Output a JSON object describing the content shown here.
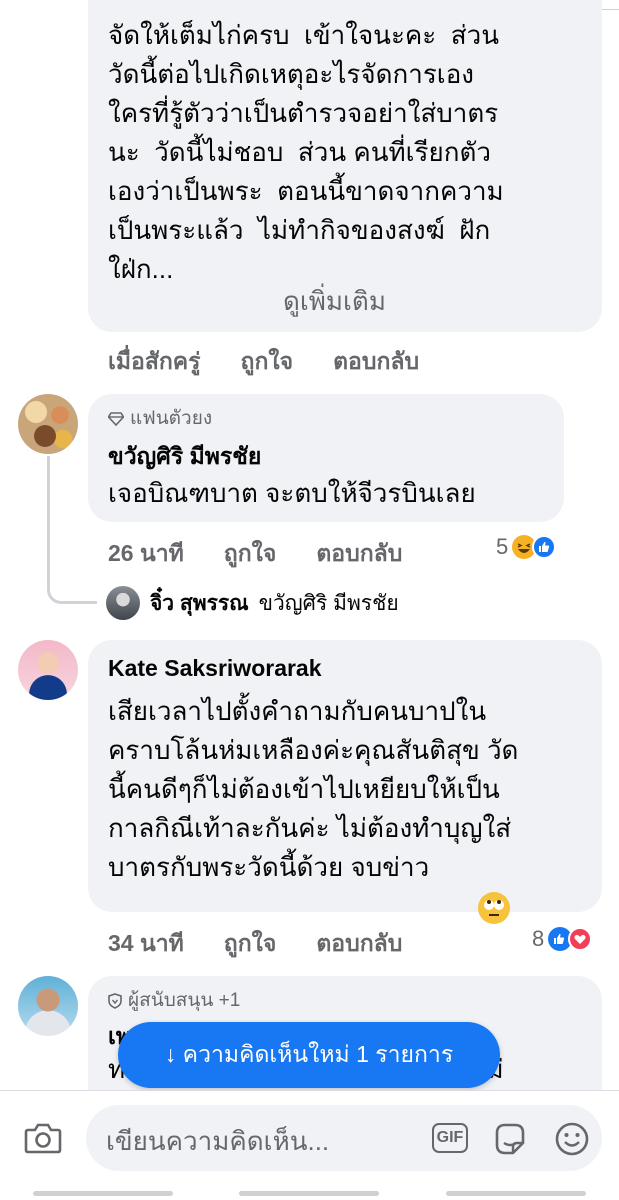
{
  "comments": [
    {
      "text": "จัดให้เต็มไก่ครบ  เข้าใจนะคะ  ส่วน\nวัดนี้ต่อไปเกิดเหตุอะไรจัดการเอง\nใครที่รู้ตัวว่าเป็นตำรวจอย่าใส่บาตร\nนะ  วัดนี้ไม่ชอบ  ส่วน คนที่เรียกตัว\nเองว่าเป็นพระ  ตอนนี้ขาดจากความ\nเป็นพระแล้ว  ไม่ทำกิจของสงฆ์  ฝัก\nใฝ่ก...",
      "see_more": "ดูเพิ่มเติม",
      "time": "เมื่อสักครู่",
      "like": "ถูกใจ",
      "reply": "ตอบกลับ"
    },
    {
      "badge": "แฟนตัวยง",
      "name": "ขวัญศิริ มีพรชัย",
      "text": "เจอบิณฑบาต จะตบให้จีวรบินเลย",
      "time": "26 นาที",
      "like": "ถูกใจ",
      "reply": "ตอบกลับ",
      "reaction_count": "5",
      "reactions": [
        "haha-icon",
        "like-icon"
      ],
      "reply_preview": {
        "name": "จิ๋ว สุพรรณ",
        "text": "ขวัญศิริ มีพรชัย"
      }
    },
    {
      "name": "Kate Saksriworarak",
      "text": "เสียเวลาไปตั้งคำถามกับคนบาปใน\nคราบโล้นห่มเหลืองค่ะคุณสันติสุข วัด\nนี้คนดีๆก็ไม่ต้องเข้าไปเหยียบให้เป็น\nกาลกิณีเท้าละกันค่ะ ไม่ต้องทำบุญใส่\nบาตรกับพระวัดนี้ด้วย จบข่าว",
      "time": "34 นาที",
      "like": "ถูกใจ",
      "reply": "ตอบกลับ",
      "reaction_count": "8",
      "reactions": [
        "like-icon",
        "love-icon"
      ]
    },
    {
      "badge": "ผู้สนับสนุน +1",
      "name": "เพ",
      "text_partial": "ท                                            รับไม่"
    }
  ],
  "new_comments_pill": "↓ ความคิดเห็นใหม่ 1 รายการ",
  "composer": {
    "placeholder": "เขียนความคิดเห็น...",
    "gif_label": "GIF"
  },
  "colors": {
    "bubble": "#f0f2f5",
    "meta": "#65676b",
    "accent": "#1877f2"
  }
}
